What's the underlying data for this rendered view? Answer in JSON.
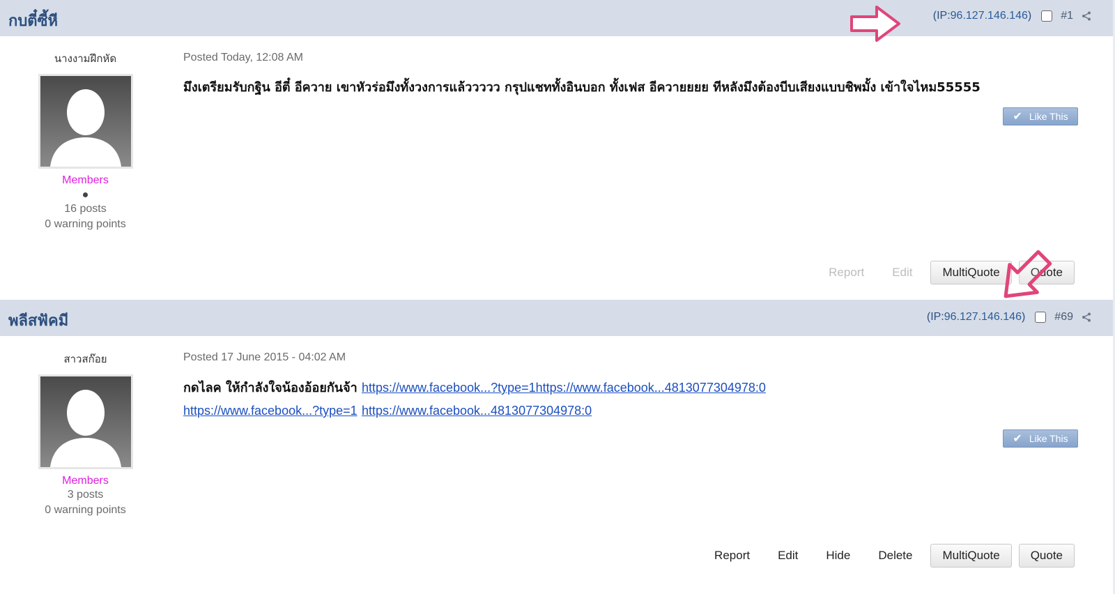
{
  "posts": [
    {
      "header_name": "กบตี๋ซี้หี",
      "ip_label": "(IP: ",
      "ip": "96.127.146.146",
      "ip_close": ")",
      "post_number": "#1",
      "nickname": "นางงามฝึกหัด",
      "group": "Members",
      "posts_count": "16 posts",
      "warning": "0 warning points",
      "date": "Posted Today, 12:08 AM",
      "body": "มึงเตรียมรับกฐิน อีตี๋ อีควาย เขาหัวร่อมึงทั้งวงการแล้ววววว กรุปแชททั้งอินบอก ทั้งเฟส อีควายยยย ทีหลังมึงต้องบีบเสียงแบบชิพมั้ง เข้าใจไหม55555",
      "like_label": "Like This",
      "actions": {
        "report": "Report",
        "edit": "Edit",
        "multiquote": "MultiQuote",
        "quote": "Quote"
      }
    },
    {
      "header_name": "พลีสฟัคมี",
      "ip_label": "(IP: ",
      "ip": "96.127.146.146",
      "ip_close": ")",
      "post_number": "#69",
      "nickname": "สาวสก๊อย",
      "group": "Members",
      "posts_count": "3 posts",
      "warning": "0 warning points",
      "date": "Posted 17 June 2015 - 04:02 AM",
      "body_text": "กดไลค ให้กำลังใจน้องอ้อยกันจ้า",
      "links": [
        "https://www.facebook...?type=1https://www.facebook...4813077304978:0",
        "https://www.facebook...?type=1",
        "https://www.facebook...4813077304978:0"
      ],
      "like_label": "Like This",
      "actions": {
        "report": "Report",
        "edit": "Edit",
        "hide": "Hide",
        "delete": "Delete",
        "multiquote": "MultiQuote",
        "quote": "Quote"
      }
    }
  ],
  "colors": {
    "header_bg": "#d6dde8",
    "header_name": "#2c4f7e",
    "group_color": "#e11de0",
    "link": "#1c4fbf",
    "like_btn": "#9bb4d6",
    "annotation_arrow": "#e0457a"
  },
  "icons": [
    "share-icon",
    "avatar-silhouette-icon",
    "check-icon",
    "pointer-arrow-icon"
  ]
}
